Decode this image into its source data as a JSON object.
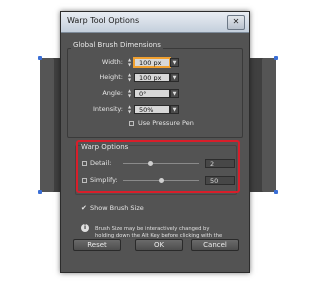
{
  "dialog": {
    "title": "Warp Tool Options",
    "close_symbol": "✕"
  },
  "global_brush_dimensions": {
    "title": "Global Brush Dimensions",
    "width": {
      "label": "Width:",
      "value": "100 px"
    },
    "height": {
      "label": "Height:",
      "value": "100 px"
    },
    "angle": {
      "label": "Angle:",
      "value": "0°"
    },
    "intensity": {
      "label": "Intensity:",
      "value": "50%"
    },
    "use_pressure_pen": {
      "label": "Use Pressure Pen",
      "checked": false
    }
  },
  "warp_options": {
    "title": "Warp Options",
    "detail": {
      "label": "Detail:",
      "value": "2",
      "checked": false,
      "fraction": 0.35
    },
    "simplify": {
      "label": "Simplify:",
      "value": "50",
      "checked": false,
      "fraction": 0.5
    }
  },
  "show_brush_size": {
    "label": "Show Brush Size",
    "checked": true
  },
  "note": "Brush Size may be interactively changed by holding down the Alt Key before clicking with the tool.",
  "buttons": {
    "reset": "Reset",
    "ok": "OK",
    "cancel": "Cancel"
  },
  "icons": {
    "info": "info-icon",
    "spinner": "spinner-arrows-icon",
    "dropdown": "dropdown-arrow-icon"
  },
  "colors": {
    "highlight": "#d81e2a",
    "focus": "#f0a030",
    "panel": "#535353"
  }
}
